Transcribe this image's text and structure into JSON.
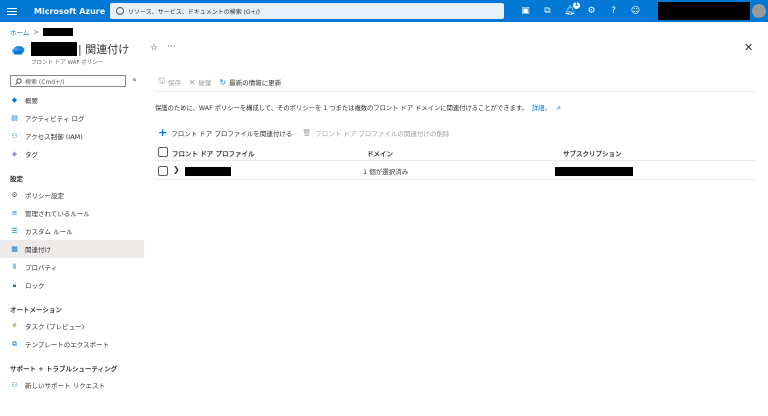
{
  "topbar": {
    "brand": "Microsoft Azure",
    "search_placeholder": "リソース、サービス、ドキュメントの検索 (G+/)",
    "notification_count": "1",
    "accent": "#0078d4"
  },
  "breadcrumb": {
    "home": "ホーム",
    "sep": ">"
  },
  "page": {
    "title": "| 関連付け",
    "subtitle": "フロント ドア WAF ポリシー",
    "star": "☆",
    "more": "···",
    "close": "✕"
  },
  "sidebar": {
    "search_placeholder": "検索 (Cmd+/)",
    "collapse": "«",
    "top_items": [
      {
        "label": "概要",
        "icon": "overview-icon"
      },
      {
        "label": "アクティビティ ログ",
        "icon": "activity-log-icon"
      },
      {
        "label": "アクセス制御 (IAM)",
        "icon": "iam-icon"
      },
      {
        "label": "タグ",
        "icon": "tag-icon"
      }
    ],
    "settings_header": "設定",
    "settings_items": [
      {
        "label": "ポリシー設定",
        "icon": "gear-icon"
      },
      {
        "label": "管理されているルール",
        "icon": "managed-rules-icon"
      },
      {
        "label": "カスタム ルール",
        "icon": "custom-rules-icon"
      },
      {
        "label": "関連付け",
        "icon": "association-icon"
      },
      {
        "label": "プロパティ",
        "icon": "properties-icon"
      },
      {
        "label": "ロック",
        "icon": "lock-icon"
      }
    ],
    "automation_header": "オートメーション",
    "automation_items": [
      {
        "label": "タスク (プレビュー)",
        "icon": "tasks-icon"
      },
      {
        "label": "テンプレートのエクスポート",
        "icon": "export-template-icon"
      }
    ],
    "support_header": "サポート + トラブルシューティング",
    "support_items": [
      {
        "label": "新しいサポート リクエスト",
        "icon": "support-request-icon"
      }
    ]
  },
  "toolbar": {
    "save": "保存",
    "discard": "破棄",
    "refresh": "最新の情報に更新"
  },
  "description": {
    "text": "保護のために、WAF ポリシーを構成して、そのポリシーを 1 つまたは複数のフロント ドア ドメインに関連付けることができます。",
    "link": "詳細。"
  },
  "actions": {
    "add": "フロント ドア プロファイルを関連付ける",
    "remove": "フロント ドア プロファイルの関連付けの削除"
  },
  "grid": {
    "headers": [
      "フロント ドア プロファイル",
      "ドメイン",
      "サブスクリプション"
    ],
    "rows": [
      {
        "domains": "1 個が選択済み"
      }
    ]
  }
}
